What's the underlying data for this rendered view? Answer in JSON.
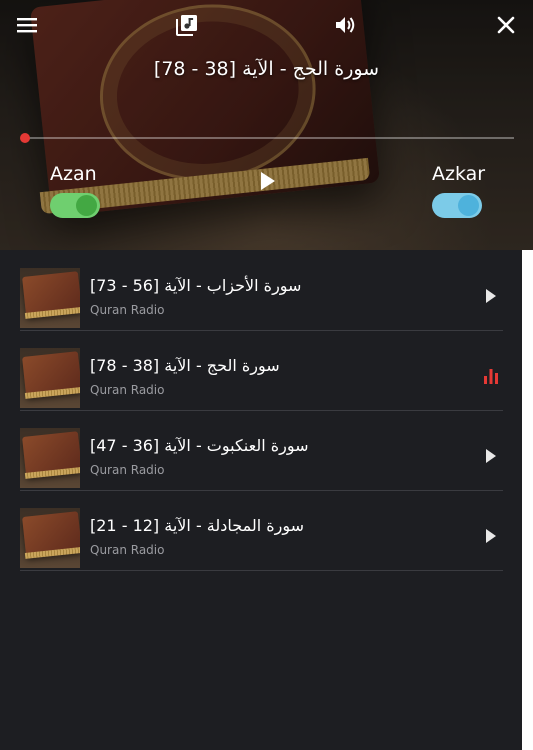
{
  "player": {
    "now_playing": "سورة الحج - الآية [38 - 78]",
    "progress_fraction": 0.0,
    "azan_label": "Azan",
    "azan_on": true,
    "azkar_label": "Azkar",
    "azkar_on": true
  },
  "icons": {
    "menu": "menu-icon",
    "playlist": "library-music-icon",
    "volume": "volume-icon",
    "close": "close-icon",
    "play": "play-icon",
    "now_playing": "equalizer-icon"
  },
  "colors": {
    "accent": "#e53935",
    "azan_toggle": "#6fcf6f",
    "azkar_toggle": "#7ccbe8",
    "list_background": "#1d1e22"
  },
  "playlist": [
    {
      "title": "سورة الأحزاب - الآية [56 - 73]",
      "subtitle": "Quran Radio",
      "state": "play"
    },
    {
      "title": "سورة الحج - الآية [38 - 78]",
      "subtitle": "Quran Radio",
      "state": "playing"
    },
    {
      "title": "سورة العنكبوت - الآية [36 - 47]",
      "subtitle": "Quran Radio",
      "state": "play"
    },
    {
      "title": "سورة المجادلة - الآية [12 - 21]",
      "subtitle": "Quran Radio",
      "state": "play"
    }
  ]
}
